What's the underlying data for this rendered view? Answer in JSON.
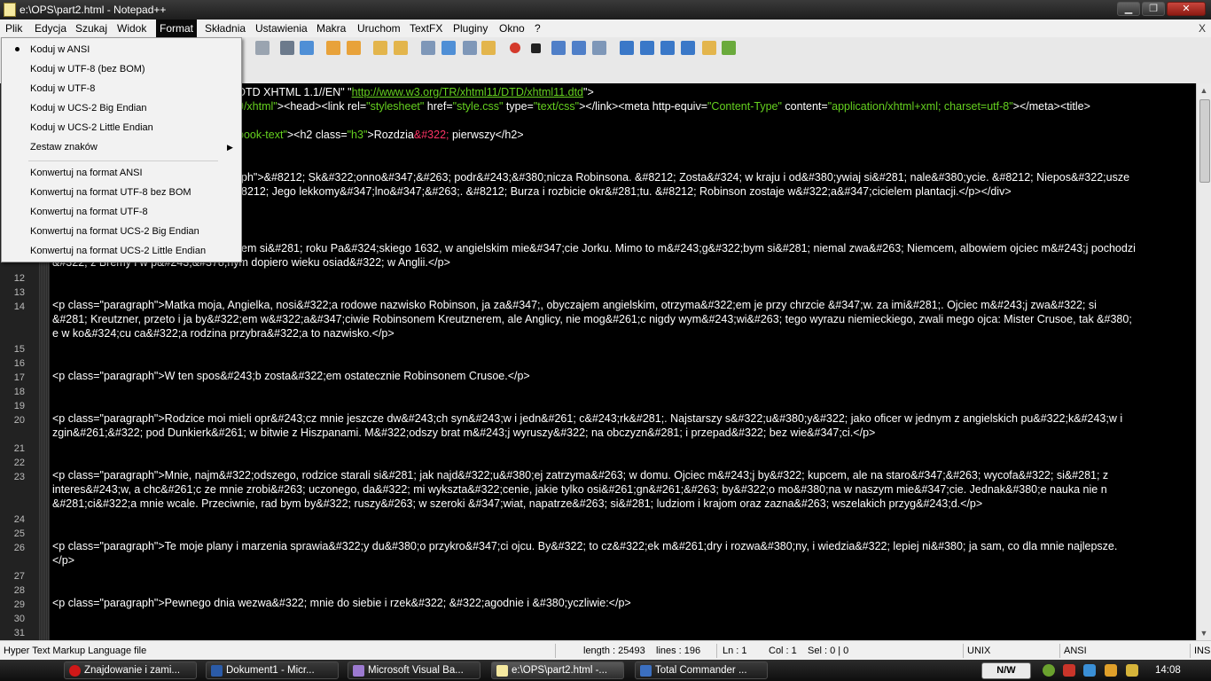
{
  "window": {
    "title": "e:\\OPS\\part2.html - Notepad++",
    "minimize": "▁",
    "maximize": "❐",
    "close": "✕"
  },
  "menubar": {
    "items": [
      "Plik",
      "Edycja",
      "Szukaj",
      "Widok",
      "Format",
      "Składnia",
      "Ustawienia",
      "Makra",
      "Uruchom",
      "TextFX",
      "Pluginy",
      "Okno",
      "?"
    ],
    "close": "X"
  },
  "format_menu": {
    "items": [
      "Koduj w ANSI",
      "Koduj w UTF-8 (bez BOM)",
      "Koduj w UTF-8",
      "Koduj w UCS-2 Big Endian",
      "Koduj w UCS-2 Little Endian",
      "Zestaw znaków",
      "Konwertuj na format ANSI",
      "Konwertuj na format UTF-8 bez BOM",
      "Konwertuj na format UTF-8",
      "Konwertuj na format UCS-2 Big Endian",
      "Konwertuj na format UCS-2 Little Endian"
    ],
    "submenu_arrow": "▶"
  },
  "editor": {
    "line_numbers": [
      "12",
      "13",
      "14",
      "15",
      "16",
      "17",
      "18",
      "19",
      "20",
      "21",
      "22",
      "23",
      "24",
      "25",
      "26",
      "27",
      "28",
      "29",
      "30",
      "31"
    ],
    "line1": {
      "t": "DTD XHTML 1.1//EN\" \"",
      "url": "http://www.w3.org/TR/xhtml11/DTD/xhtml11.dtd",
      "end": "\">"
    },
    "line2": {
      "a": "9/xhtml\"",
      "b": "><head><link rel=",
      "c": "\"stylesheet\"",
      "d": " href=",
      "e": "\"style.css\"",
      "f": " type=",
      "g": "\"text/css\"",
      "h": "></link><meta http-equiv=",
      "i": "\"Content-Type\"",
      "j": " content=",
      "k": "\"application/xhtml+xml; charset=utf-8\"",
      "l": "></meta><title>"
    },
    "line3": {
      "a": "book-text\"",
      "b": "><h2 class=",
      "c": "\"h3\"",
      "d": ">Rozdzia",
      "e": "&#322;",
      "f": " pierwszy</h2>"
    },
    "line4a": "ph\">&#8212; Sk&#322;onno&#347;&#263; podr&#243;&#380;nicza Robinsona. &#8212; Zosta&#324; w kraju i od&#380;ywiaj si&#281; nale&#380;ycie. &#8212; Niepos&#322;usze",
    "line4b": "8212; Jego lekkomy&#347;lno&#347;&#263;. &#8212; Burza i rozbicie okr&#281;tu. &#8212; Robinson zostaje w&#322;a&#347;cicielem plantacji.</p></div>",
    "line5a": "em si&#281; roku Pa&#324;skiego 1632, w angielskim mie&#347;cie Jorku. Mimo to m&#243;g&#322;bym si&#281; niemal zwa&#263; Niemcem, albowiem ojciec m&#243;j pochodzi",
    "line5b": "&#322; z Bremy i w p&#243;&#378;nym dopiero wieku osiad&#322; w Anglii.</p>",
    "p14a": "<p class=\"paragraph\">Matka moja, Angielka, nosi&#322;a rodowe nazwisko Robinson, ja za&#347;, obyczajem angielskim, otrzyma&#322;em je przy chrzcie &#347;w. za imi&#281;. Ojciec m&#243;j zwa&#322; si",
    "p14b": "&#281; Kreutzner, przeto i ja by&#322;em w&#322;a&#347;ciwie Robinsonem Kreutznerem, ale Anglicy, nie mog&#261;c nigdy wym&#243;wi&#263; tego wyrazu niemieckiego, zwali mego ojca: Mister Crusoe, tak &#380;",
    "p14c": "e w ko&#324;cu ca&#322;a rodzina przybra&#322;a to nazwisko.</p>",
    "p17": "<p class=\"paragraph\">W ten spos&#243;b zosta&#322;em ostatecznie Robinsonem Crusoe.</p>",
    "p20a": "<p class=\"paragraph\">Rodzice moi mieli opr&#243;cz mnie jeszcze dw&#243;ch syn&#243;w i jedn&#261; c&#243;rk&#281;. Najstarszy s&#322;u&#380;y&#322; jako oficer w jednym z angielskich pu&#322;k&#243;w i",
    "p20b": "zgin&#261;&#322; pod Dunkierk&#261; w bitwie z Hiszpanami. M&#322;odszy brat m&#243;j wyruszy&#322; na obczyzn&#281; i przepad&#322; bez wie&#347;ci.</p>",
    "p23a": "<p class=\"paragraph\">Mnie, najm&#322;odszego, rodzice starali si&#281; jak najd&#322;u&#380;ej zatrzyma&#263; w domu. Ojciec m&#243;j by&#322; kupcem, ale na staro&#347;&#263; wycofa&#322; si&#281; z",
    "p23b": "interes&#243;w, a chc&#261;c ze mnie zrobi&#263; uczonego, da&#322; mi wykszta&#322;cenie, jakie tylko osi&#261;gn&#261;&#263; by&#322;o mo&#380;na w naszym mie&#347;cie. Jednak&#380;e nauka nie n",
    "p23c": "&#281;ci&#322;a mnie wcale. Przeciwnie, rad bym by&#322; ruszy&#263; w szeroki &#347;wiat, napatrze&#263; si&#281; ludziom i krajom oraz zazna&#263; wszelakich przyg&#243;d.</p>",
    "p26a": "<p class=\"paragraph\">Te moje plany i marzenia sprawia&#322;y du&#380;o przykro&#347;ci ojcu. By&#322; to cz&#322;ek m&#261;dry i rozwa&#380;ny, i wiedzia&#322; lepiej ni&#380; ja sam, co dla mnie najlepsze.",
    "p26b": "</p>",
    "p29": "<p class=\"paragraph\">Pewnego dnia wezwa&#322; mnie do siebie i rzek&#322; &#322;agodnie i &#380;yczliwie:</p>"
  },
  "status": {
    "filetype": "Hyper Text Markup Language file",
    "length": "length : 25493",
    "lines": "lines : 196",
    "ln": "Ln : 1",
    "col": "Col : 1",
    "sel": "Sel : 0 | 0",
    "eol": "UNIX",
    "encoding": "ANSI",
    "mode": "INS"
  },
  "taskbar": {
    "items": [
      "Znajdowanie i zami...",
      "Dokument1 - Micr...",
      "Microsoft Visual Ba...",
      "e:\\OPS\\part2.html -...",
      "Total Commander ..."
    ],
    "lang": "N/W",
    "clock": "14:08"
  },
  "colors": {
    "accent_string": "#65d01f",
    "entity": "#ff3366",
    "editor_bg": "#000000"
  }
}
